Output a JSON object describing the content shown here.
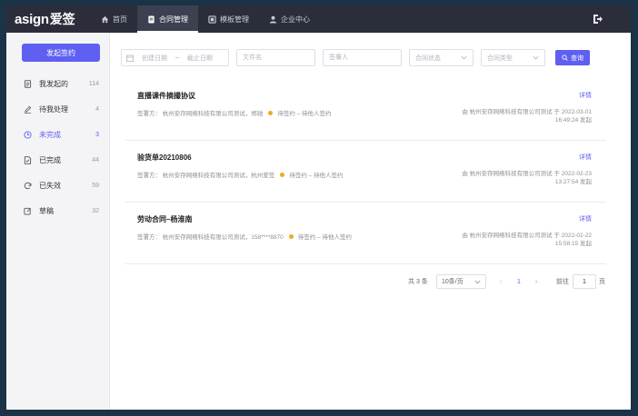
{
  "app": {
    "logo_word": "asign",
    "logo_cn": "爱签"
  },
  "nav": {
    "items": [
      {
        "label": "首页",
        "icon": "home-icon"
      },
      {
        "label": "合同管理",
        "icon": "contract-icon"
      },
      {
        "label": "模板管理",
        "icon": "template-icon"
      },
      {
        "label": "企业中心",
        "icon": "user-icon"
      }
    ],
    "active_index": 1,
    "logout_icon": "logout-icon"
  },
  "sidebar": {
    "new_button": "发起签约",
    "items": [
      {
        "label": "我发起的",
        "count": "114",
        "icon": "doc-icon"
      },
      {
        "label": "待我处理",
        "count": "4",
        "icon": "pen-icon"
      },
      {
        "label": "未完成",
        "count": "3",
        "icon": "clock-icon"
      },
      {
        "label": "已完成",
        "count": "44",
        "icon": "check-doc-icon"
      },
      {
        "label": "已失效",
        "count": "59",
        "icon": "refresh-icon"
      },
      {
        "label": "草稿",
        "count": "32",
        "icon": "edit-icon"
      }
    ],
    "active_index": 2
  },
  "filters": {
    "date_start_placeholder": "创建日期",
    "date_sep": "–",
    "date_end_placeholder": "截止日期",
    "filename_placeholder": "文件名",
    "signer_placeholder": "签署人",
    "status_placeholder": "合同状态",
    "type_placeholder": "合同类型",
    "query_button": "查询"
  },
  "contracts": [
    {
      "title": "直播课件摘撮协议",
      "detail": "详情",
      "signers": "签署方：  杭州安存网络科技有限公司测试，郑驰",
      "status": "待签约 – 待他人签约",
      "from": "由 杭州安存网络科技有限公司测试 于 2022-03-01",
      "time": "16:49:24 发起"
    },
    {
      "title": "验货单20210806",
      "detail": "详情",
      "signers": "签署方：  杭州安存网络科技有限公司测试，杭州爱签",
      "status": "待签约 – 待他人签约",
      "from": "由 杭州安存网络科技有限公司测试 于 2022-02-23",
      "time": "13:27:54 发起"
    },
    {
      "title": "劳动合同–杨淮南",
      "detail": "详情",
      "signers": "签署方：  杭州安存网络科技有限公司测试，158****8870",
      "status": "待签约 – 待他人签约",
      "from": "由 杭州安存网络科技有限公司测试 于 2022-02-22",
      "time": "15:58:15 发起"
    }
  ],
  "pagination": {
    "total": "共 3 条",
    "page_size": "10条/页",
    "prev": "‹",
    "current": "1",
    "next": "›",
    "goto_label": "前往",
    "goto_value": "1",
    "page_suffix": "页"
  },
  "colors": {
    "accent": "#5f5ff2",
    "topbar": "#2b2e3a",
    "status_dot": "#f5a623"
  }
}
